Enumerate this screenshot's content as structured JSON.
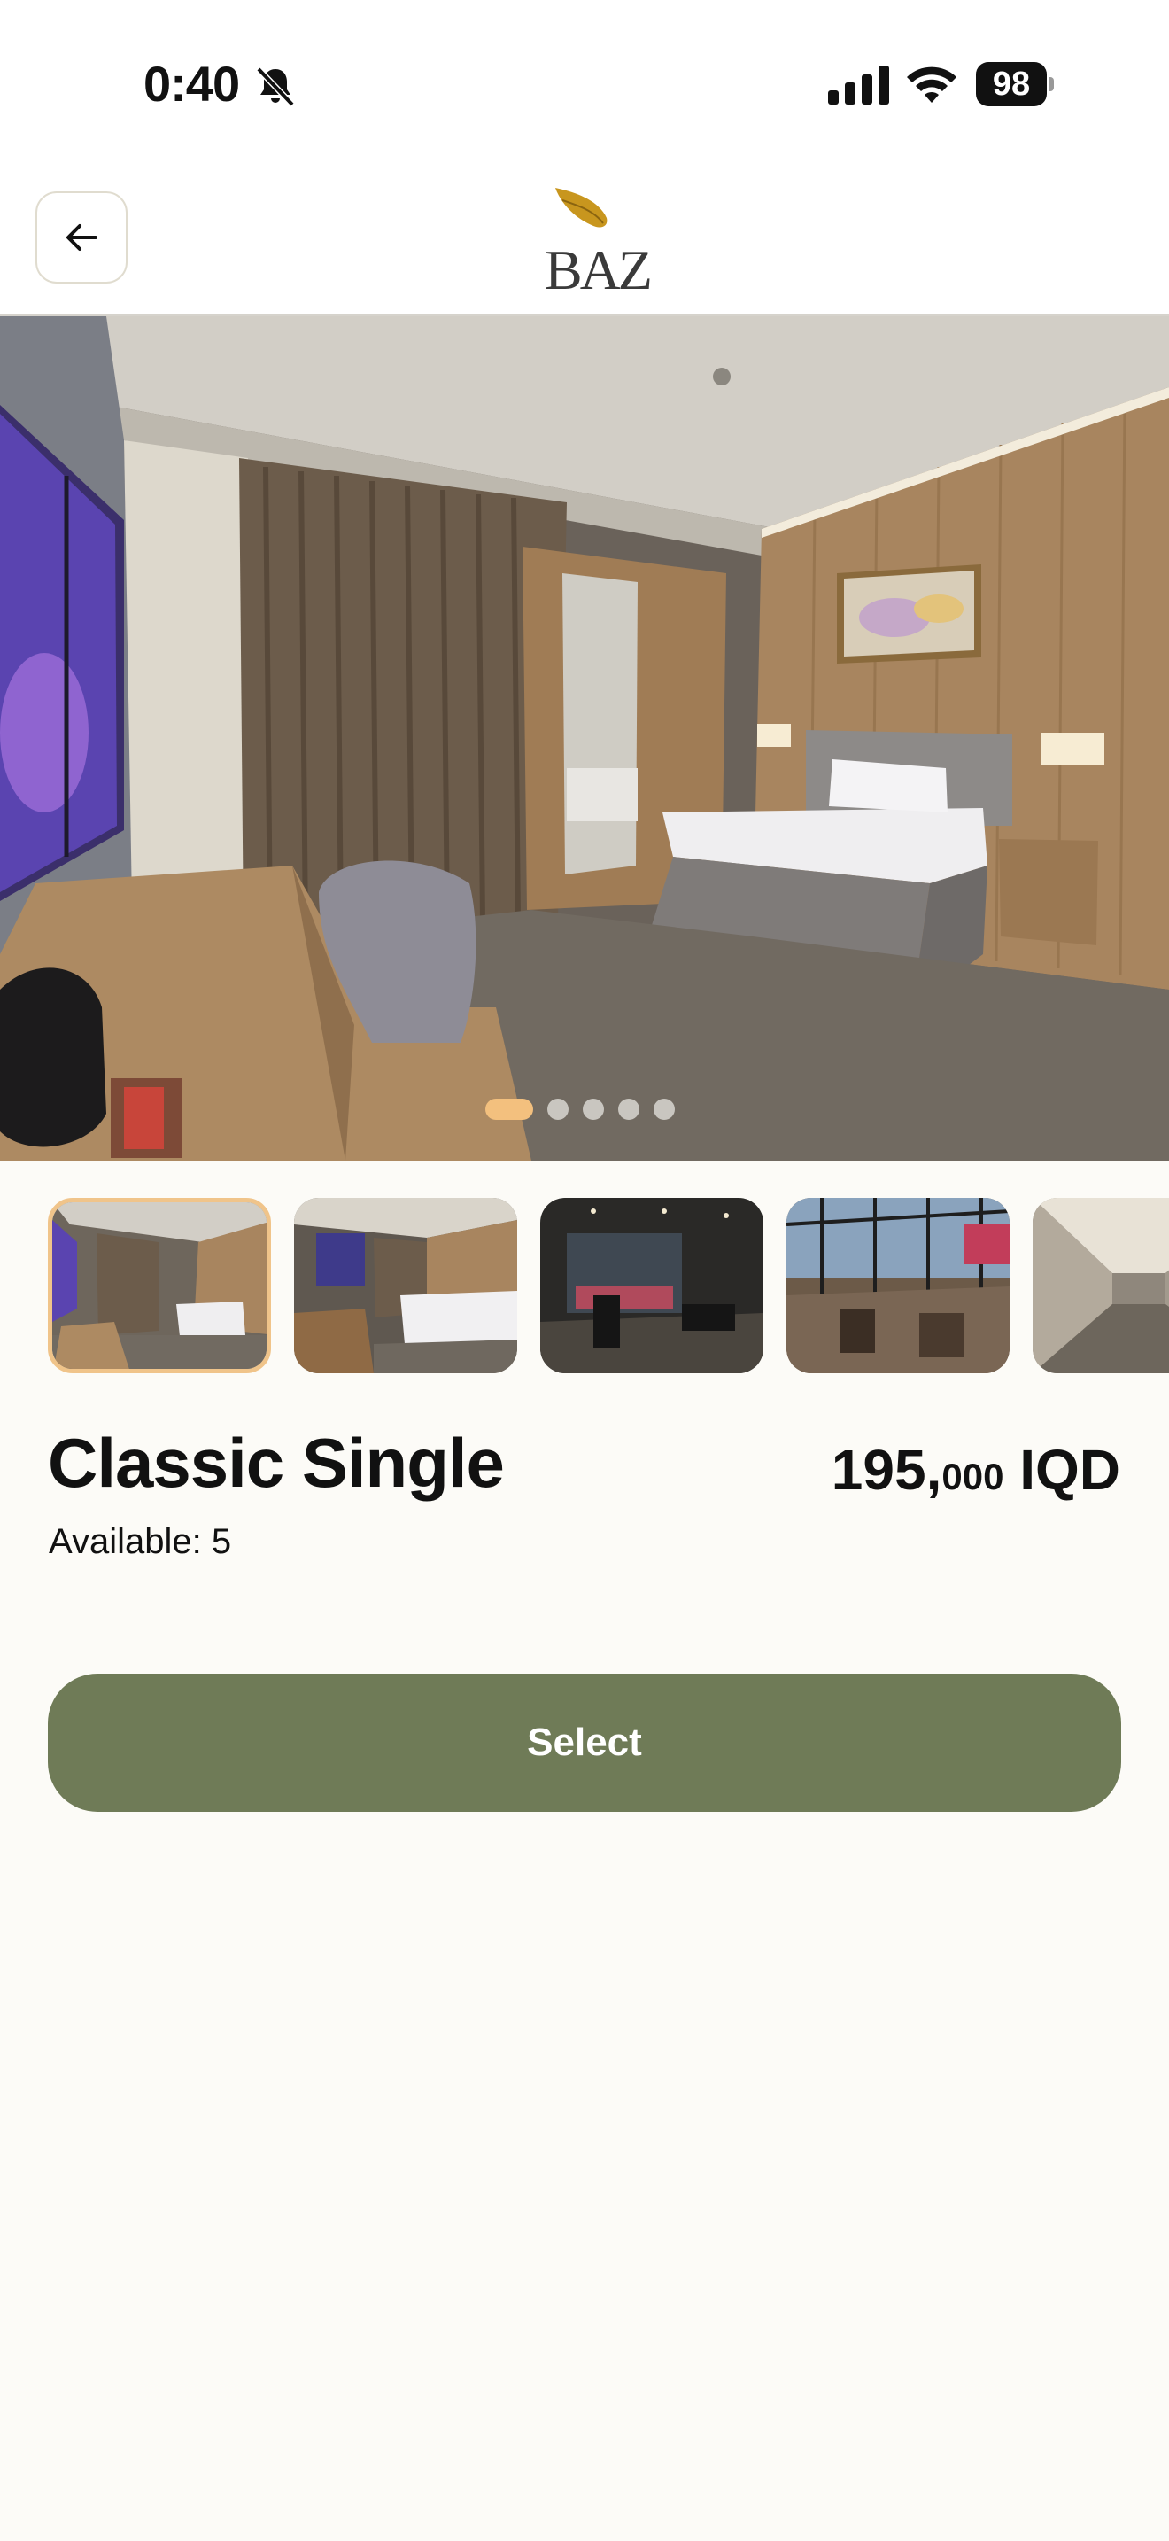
{
  "status_bar": {
    "time": "0:40",
    "battery": "98",
    "icons": [
      "bell-slash-icon",
      "cellular-signal-icon",
      "wifi-icon",
      "battery-icon"
    ]
  },
  "header": {
    "back_icon": "arrow-left-icon",
    "logo_text": "BAZ",
    "logo_color": "#c8961e"
  },
  "gallery": {
    "image_count": 5,
    "active_index": 0,
    "dot_active_color": "#f3c07e",
    "thumbnails": [
      {
        "name": "thumb-room-single"
      },
      {
        "name": "thumb-room-twin"
      },
      {
        "name": "thumb-gym"
      },
      {
        "name": "thumb-terrace"
      },
      {
        "name": "thumb-corridor"
      }
    ]
  },
  "room": {
    "name": "Classic Single",
    "price_main": "195,",
    "price_thousand": "000",
    "currency": " IQD",
    "available_label": "Available: ",
    "available_count": "5"
  },
  "actions": {
    "select_label": "Select",
    "button_color": "#6f7b57"
  }
}
